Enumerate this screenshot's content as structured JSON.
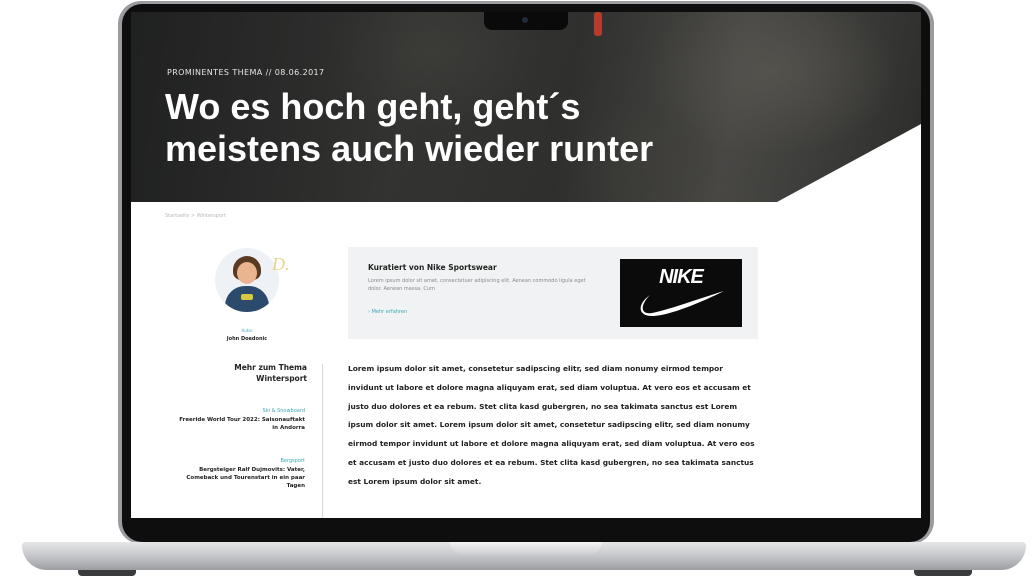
{
  "article": {
    "kicker": "PROMINENTES THEMA // 08.06.2017",
    "title": "Wo es hoch geht, geht´s meistens auch wieder runter",
    "breadcrumb": "Startseite  >  Wintersport"
  },
  "author": {
    "role": "Autor",
    "name": "John Doedonic"
  },
  "sidebar": {
    "more_label": "Mehr zum Thema Wintersport",
    "related": [
      {
        "category": "Ski & Snowboard",
        "headline": "Freeride World Tour 2022: Saisonauftakt in Andorra"
      },
      {
        "category": "Bergsport",
        "headline": "Bergsteiger Ralf Dujmovits: Vater, Comeback und Tourenstart in ein paar Tagen"
      }
    ]
  },
  "sponsor": {
    "title": "Kuratiert von Nike Sportswear",
    "text": "Lorem ipsum dolor sit amet, consectetuer adipiscing elit. Aenean commodo ligula eget dolor. Aenean massa. Cum",
    "link": "Mehr erfahren",
    "logo_text": "NIKE"
  },
  "body": {
    "text": "Lorem ipsum dolor sit amet, consetetur sadipscing elitr, sed diam nonumy eirmod tempor invidunt ut labore et dolore magna aliquyam erat, sed diam voluptua. At vero eos et accusam et justo duo dolores et ea rebum. Stet clita kasd gubergren, no sea takimata sanctus est Lorem ipsum dolor sit amet. Lorem ipsum dolor sit amet, consetetur sadipscing elitr, sed diam nonumy eirmod tempor invidunt ut labore et dolore magna aliquyam erat, sed diam voluptua. At vero eos et accusam et justo duo dolores et ea rebum. Stet clita kasd gubergren, no sea takimata sanctus est Lorem ipsum dolor sit amet."
  },
  "colors": {
    "accent": "#39a9b5",
    "text": "#1e1e1e",
    "sponsor_bg": "#f1f2f3"
  }
}
